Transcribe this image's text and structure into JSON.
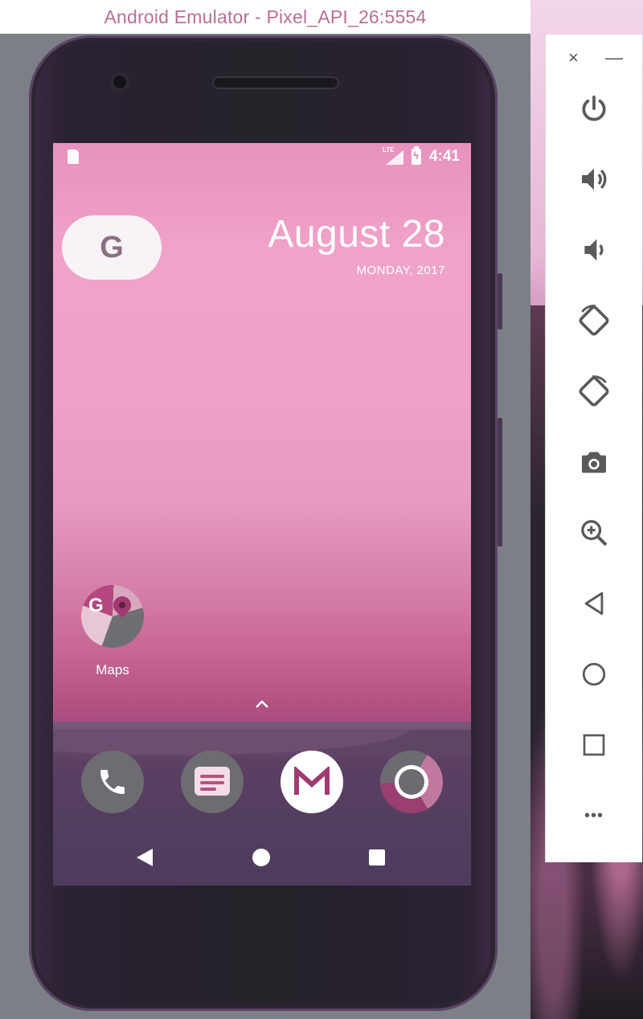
{
  "window": {
    "title": "Android Emulator - Pixel_API_26:5554"
  },
  "status_bar": {
    "time": "4:41",
    "network": "LTE"
  },
  "widget": {
    "google_letter": "G",
    "date": "August 28",
    "day": "MONDAY, 2017"
  },
  "home": {
    "apps": [
      {
        "label": "Maps"
      }
    ],
    "drawer_arrow": "^",
    "dock": [
      "Phone",
      "Messages",
      "Gmail",
      "Chrome"
    ]
  },
  "toolbar": {
    "close": "×",
    "minimize": "—",
    "more": "•••",
    "tools": [
      "power-icon",
      "volume-up-icon",
      "volume-down-icon",
      "rotate-left-icon",
      "rotate-right-icon",
      "camera-icon",
      "zoom-icon",
      "back-icon",
      "home-icon",
      "overview-icon",
      "more-icon"
    ]
  },
  "colors": {
    "title_text": "#b86f97",
    "icon_gray": "#5a5a5a",
    "wallpaper_pink": "#f0a3c8",
    "accent_magenta": "#a03b70"
  }
}
